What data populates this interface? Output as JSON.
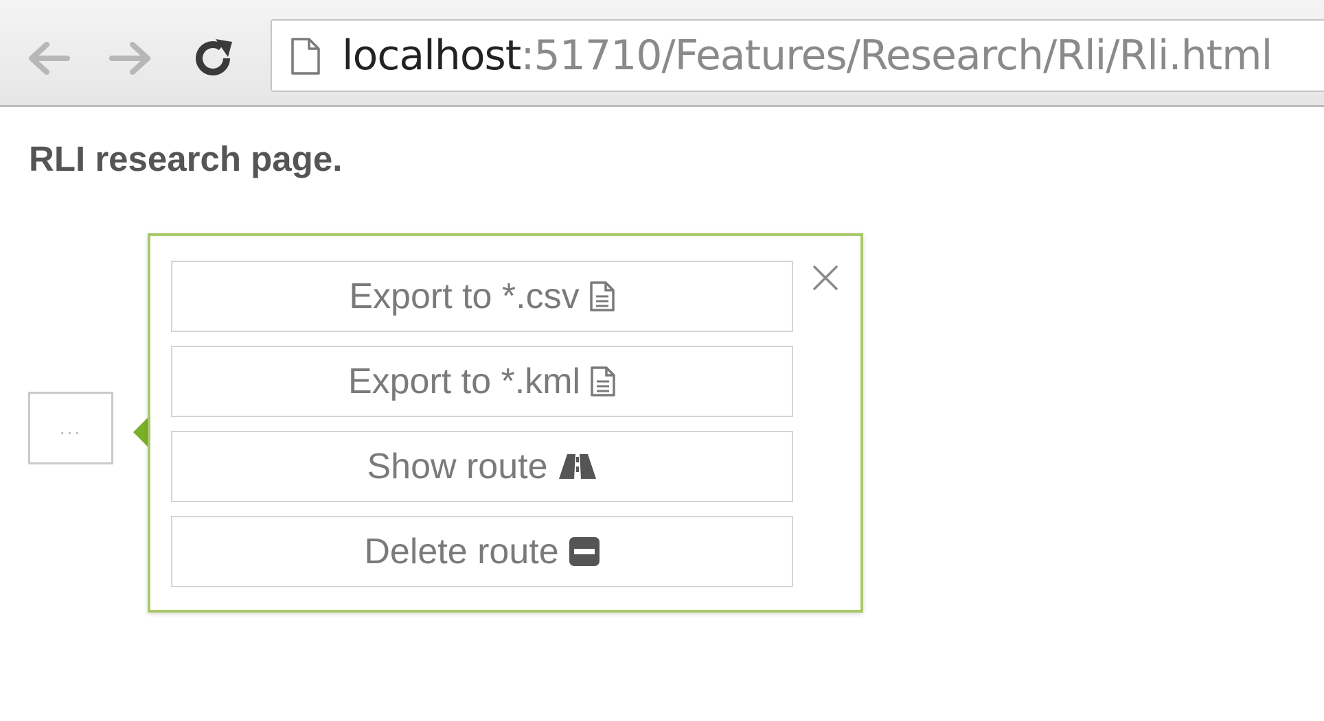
{
  "browser": {
    "url_host": "localhost",
    "url_path": ":51710/Features/Research/Rli/Rli.html"
  },
  "page": {
    "heading": "RLI research page.",
    "more_button_label": "..."
  },
  "popover": {
    "buttons": [
      {
        "label": "Export to *.csv",
        "icon": "file-icon"
      },
      {
        "label": "Export to *.kml",
        "icon": "file-icon"
      },
      {
        "label": "Show route",
        "icon": "road-icon"
      },
      {
        "label": "Delete route",
        "icon": "minus-square-icon"
      }
    ]
  },
  "colors": {
    "popover_border": "#a9c86a",
    "popover_arrow": "#7aaf2a",
    "button_text": "#7a7a7a"
  }
}
